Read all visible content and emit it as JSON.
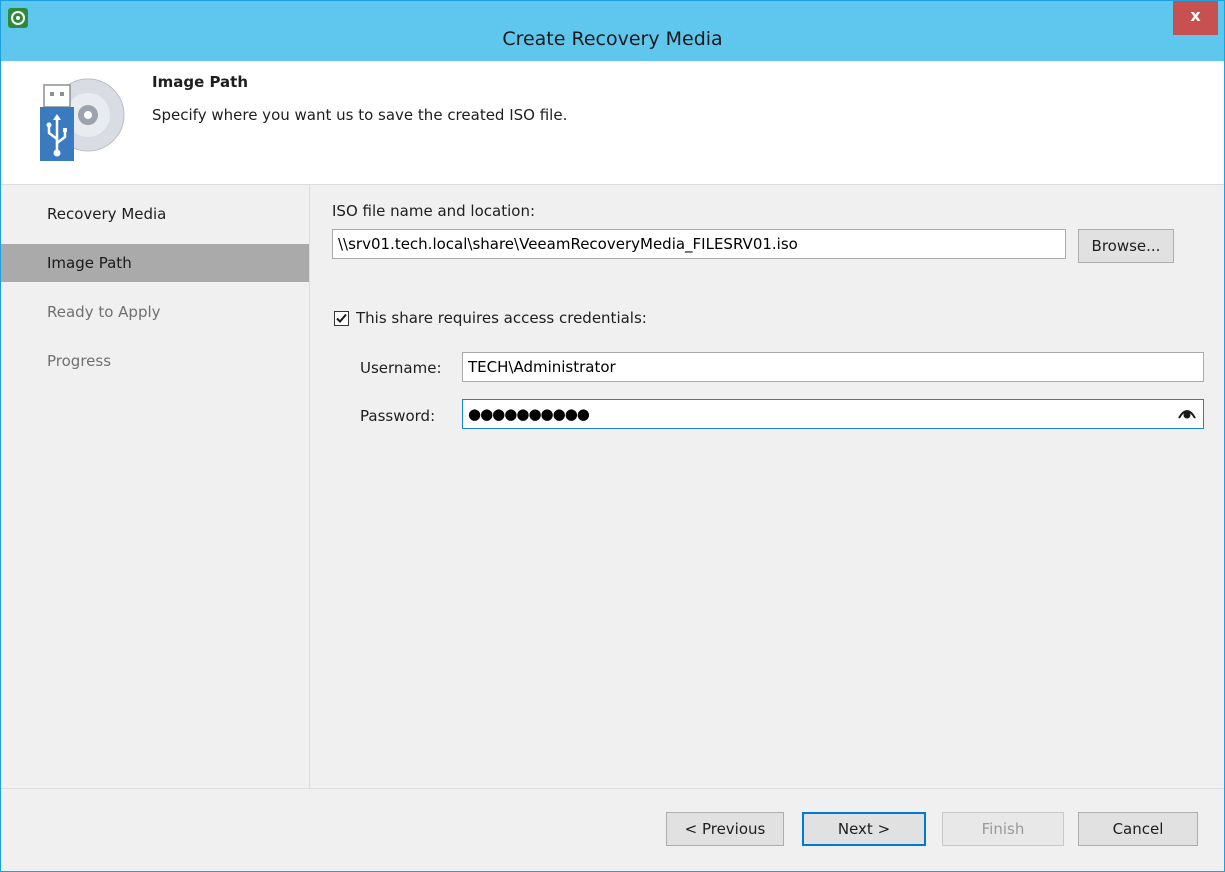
{
  "window": {
    "title": "Create Recovery Media",
    "close_glyph": "x"
  },
  "header": {
    "title": "Image Path",
    "description": "Specify where you want us to save the created ISO file.",
    "icon": "usb-disc-icon"
  },
  "steps": [
    {
      "label": "Recovery Media",
      "state": "done"
    },
    {
      "label": "Image Path",
      "state": "active"
    },
    {
      "label": "Ready to Apply",
      "state": "disabled"
    },
    {
      "label": "Progress",
      "state": "disabled"
    }
  ],
  "form": {
    "iso_label": "ISO file name and location:",
    "iso_value": "\\\\srv01.tech.local\\share\\VeeamRecoveryMedia_FILESRV01.iso",
    "browse_label": "Browse...",
    "credentials_checkbox_label": "This share requires access credentials:",
    "credentials_checked": true,
    "username_label": "Username:",
    "username_value": "TECH\\Administrator",
    "password_label": "Password:",
    "password_value": "●●●●●●●●●●"
  },
  "footer": {
    "previous_label": "< Previous",
    "next_label": "Next >",
    "finish_label": "Finish",
    "cancel_label": "Cancel"
  },
  "colors": {
    "titlebar": "#5fc7ee",
    "close_button": "#c75050",
    "active_step": "#aaaaaa",
    "focus_border": "#1883d7"
  }
}
